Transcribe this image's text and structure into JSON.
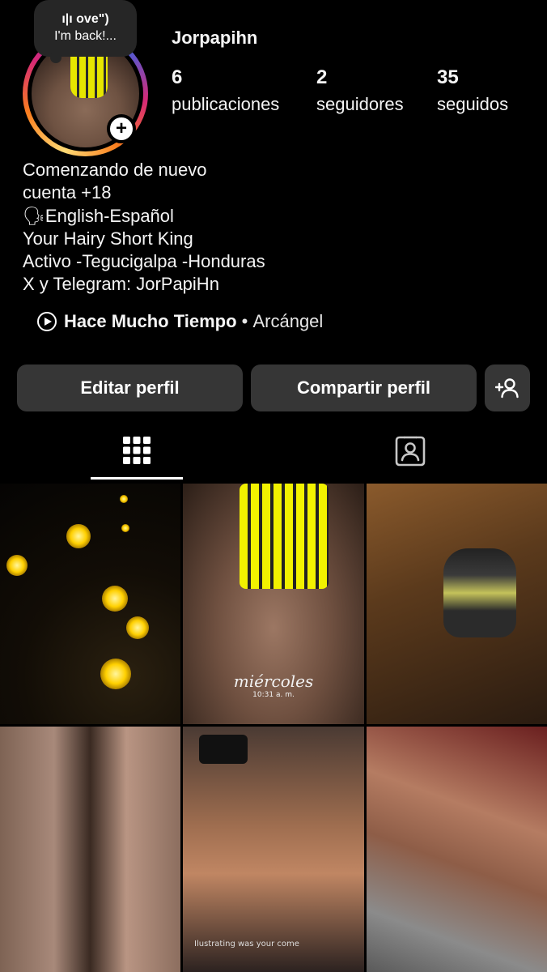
{
  "note": {
    "music": "ı|ı ove\")",
    "text": "I'm back!..."
  },
  "profile": {
    "username": "Jorpapihn",
    "stats": [
      {
        "count": "6",
        "label": "publicaciones"
      },
      {
        "count": "2",
        "label": "seguidores"
      },
      {
        "count": "35",
        "label": "seguidos"
      }
    ],
    "bio": [
      "Comenzando de nuevo",
      "cuenta +18",
      "🗣English-Español",
      "Your Hairy Short King",
      "Activo -Tegucigalpa -Honduras",
      "X y Telegram: JorPapiHn"
    ],
    "music": {
      "song": "Hace Mucho Tiempo",
      "separator": " • ",
      "artist": "Arcángel"
    }
  },
  "buttons": {
    "edit": "Editar perfil",
    "share": "Compartir perfil"
  },
  "tabs": {
    "active": "grid"
  },
  "posts": [
    {
      "caption": ""
    },
    {
      "caption": "miércoles",
      "subcaption": "10:31 a. m."
    },
    {
      "caption": ""
    },
    {
      "caption": ""
    },
    {
      "caption": "",
      "footer": "Ilustrating was your come"
    },
    {
      "caption": ""
    }
  ],
  "icons": {
    "add_story": "plus-icon",
    "music": "play-circle-icon",
    "add_person": "person-add-icon",
    "grid_tab": "grid-icon",
    "tagged_tab": "tagged-person-icon"
  }
}
